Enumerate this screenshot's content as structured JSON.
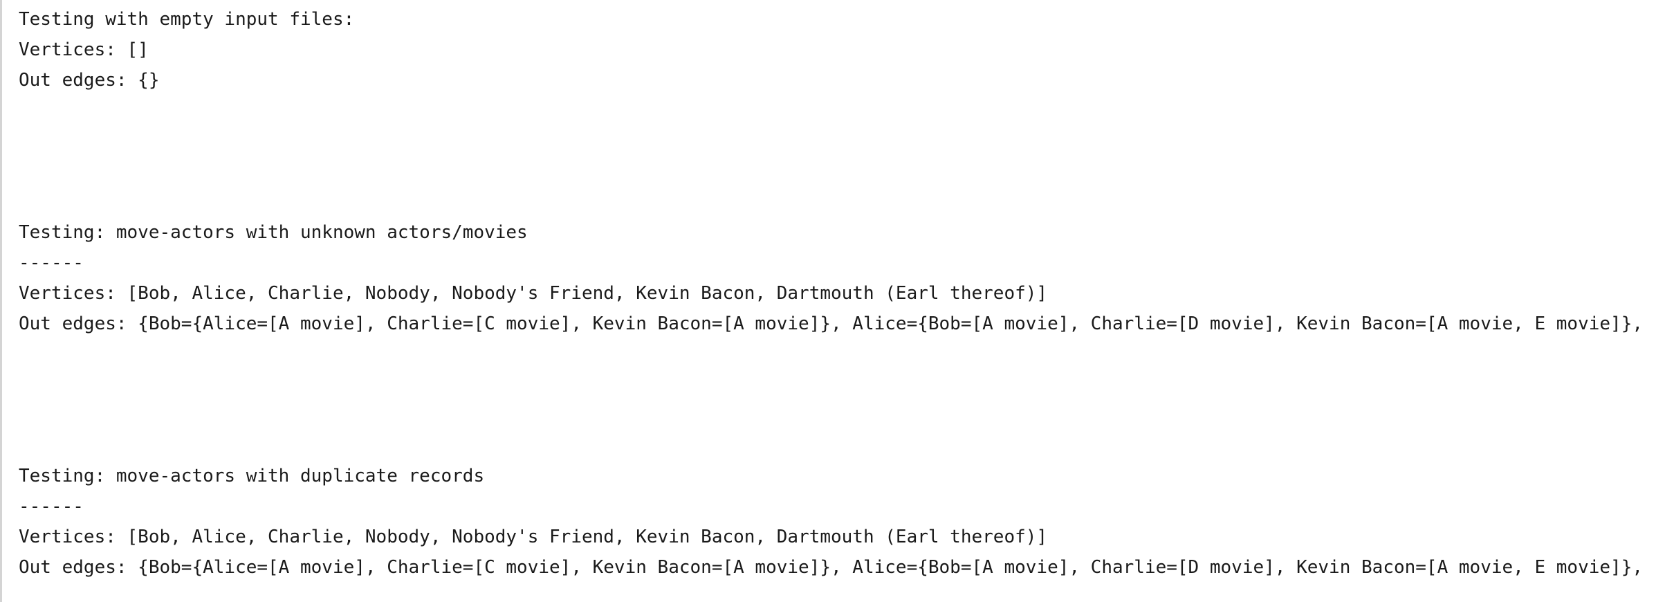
{
  "console": {
    "lines": [
      "Testing with empty input files:",
      "Vertices: []",
      "Out edges: {}",
      "Testing: move-actors with unknown actors/movies",
      "------",
      "Vertices: [Bob, Alice, Charlie, Nobody, Nobody's Friend, Kevin Bacon, Dartmouth (Earl thereof)]",
      "Out edges: {Bob={Alice=[A movie], Charlie=[C movie], Kevin Bacon=[A movie]}, Alice={Bob=[A movie], Charlie=[D movie], Kevin Bacon=[A movie, E movie]},",
      "Testing: move-actors with duplicate records",
      "------",
      "Vertices: [Bob, Alice, Charlie, Nobody, Nobody's Friend, Kevin Bacon, Dartmouth (Earl thereof)]",
      "Out edges: {Bob={Alice=[A movie], Charlie=[C movie], Kevin Bacon=[A movie]}, Alice={Bob=[A movie], Charlie=[D movie], Kevin Bacon=[A movie, E movie]},"
    ]
  }
}
